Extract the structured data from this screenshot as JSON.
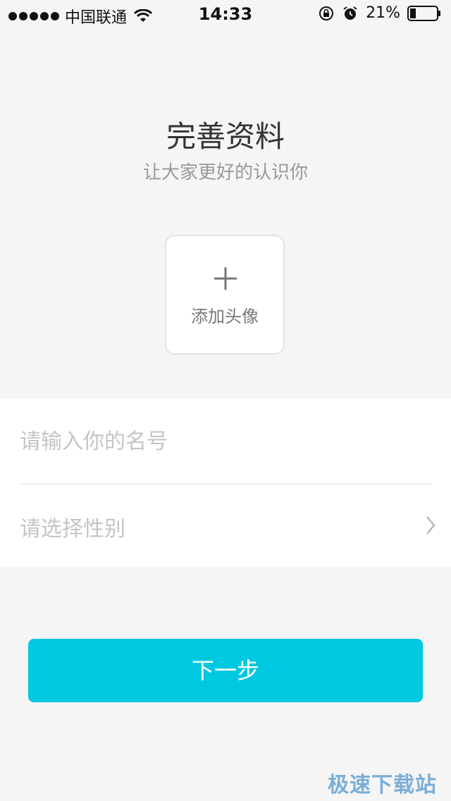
{
  "status_bar": {
    "carrier": "中国联通",
    "time": "14:33",
    "battery": "21%",
    "icons": [
      "signal-dots-icon",
      "wifi-icon",
      "rotation-lock-icon",
      "alarm-icon",
      "battery-icon"
    ]
  },
  "header": {
    "title": "完善资料",
    "subtitle": "让大家更好的认识你"
  },
  "avatar": {
    "label": "添加头像",
    "icon": "plus-icon"
  },
  "form": {
    "name_placeholder": "请输入你的名号",
    "name_value": "",
    "gender_placeholder": "请选择性别",
    "gender_icon": "chevron-right-icon"
  },
  "actions": {
    "next_label": "下一步"
  },
  "watermark": "极速下载站",
  "colors": {
    "accent": "#00c8e0",
    "background": "#f5f5f5",
    "placeholder": "#c4c4c4"
  }
}
